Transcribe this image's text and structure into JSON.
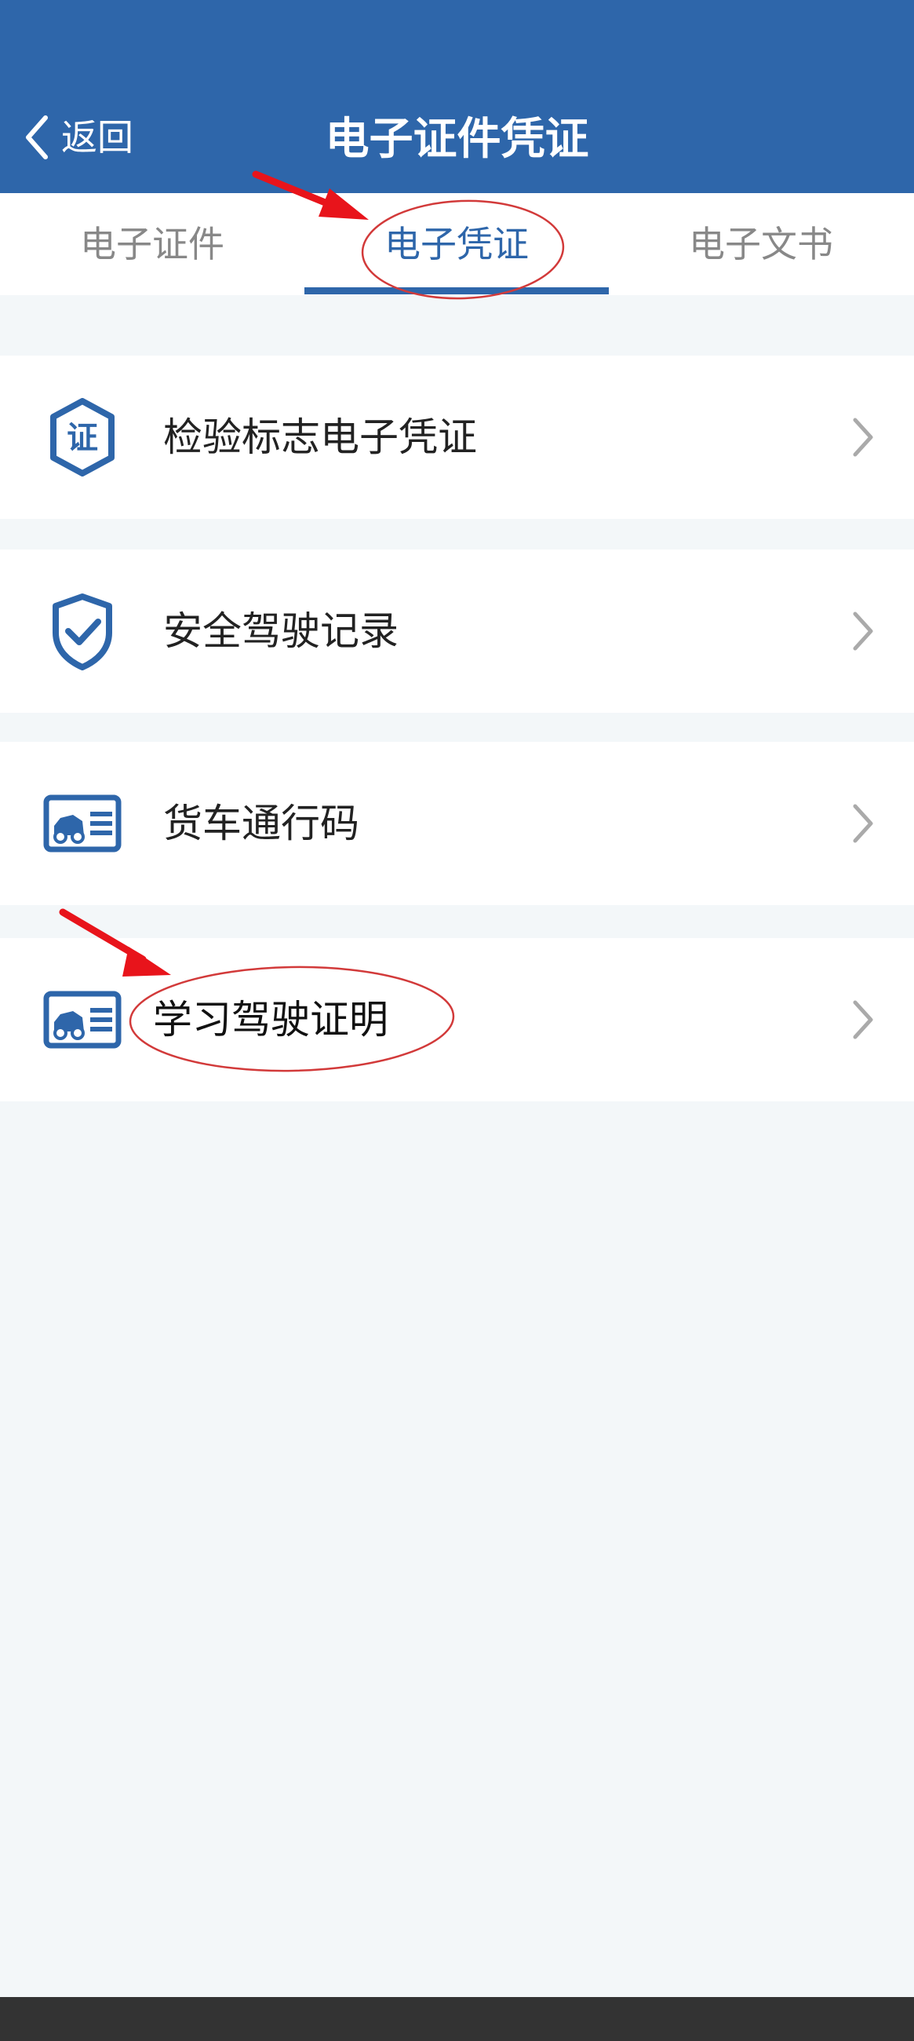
{
  "header": {
    "back_label": "返回",
    "title": "电子证件凭证"
  },
  "tabs": [
    {
      "label": "电子证件",
      "active": false
    },
    {
      "label": "电子凭证",
      "active": true
    },
    {
      "label": "电子文书",
      "active": false
    }
  ],
  "list": [
    {
      "label": "检验标志电子凭证",
      "icon": "certificate-shield-icon"
    },
    {
      "label": "安全驾驶记录",
      "icon": "shield-check-icon"
    },
    {
      "label": "货车通行码",
      "icon": "vehicle-card-icon"
    },
    {
      "label": "学习驾驶证明",
      "icon": "vehicle-card-icon"
    }
  ],
  "icons": {
    "certificate_glyph": "证"
  },
  "colors": {
    "brand_blue": "#2e66aa",
    "background": "#f3f7f9",
    "annotation_red": "#e8141b",
    "inactive_tab": "#888888"
  }
}
